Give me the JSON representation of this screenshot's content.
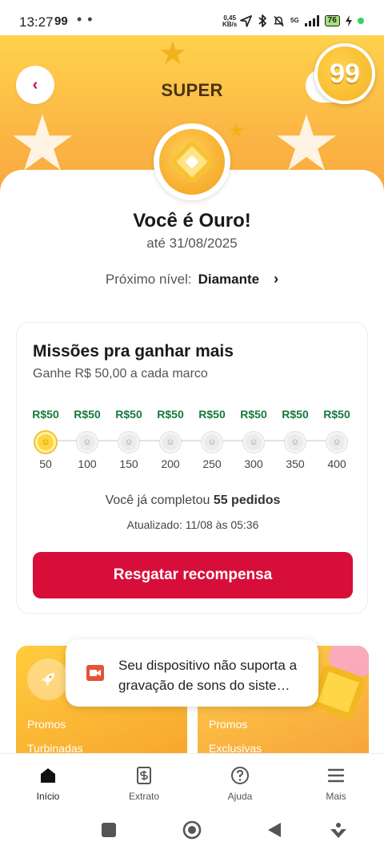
{
  "status_bar": {
    "time": "13:27",
    "app_logo": "99",
    "dots": "• •",
    "net_speed_value": "0,45",
    "net_speed_unit": "KB/s",
    "signal_label": "5G",
    "battery": "76"
  },
  "header": {
    "title": "SUPER",
    "back_icon": "‹",
    "logo_text": "99"
  },
  "level": {
    "title": "Você é Ouro!",
    "until": "até 31/08/2025",
    "next_label": "Próximo nível:",
    "next_value": "Diamante",
    "next_chevron": "›"
  },
  "missions": {
    "title": "Missões pra ganhar mais",
    "subtitle": "Ganhe R$ 50,00 a cada marco",
    "steps": [
      {
        "reward": "R$50",
        "count": "50"
      },
      {
        "reward": "R$50",
        "count": "100"
      },
      {
        "reward": "R$50",
        "count": "150"
      },
      {
        "reward": "R$50",
        "count": "200"
      },
      {
        "reward": "R$50",
        "count": "250"
      },
      {
        "reward": "R$50",
        "count": "300"
      },
      {
        "reward": "R$50",
        "count": "350"
      },
      {
        "reward": "R$50",
        "count": "400"
      }
    ],
    "completed_prefix": "Você já completou",
    "completed_value": "55 pedidos",
    "updated": "Atualizado: 11/08 às 05:36",
    "button": "Resgatar recompensa"
  },
  "promos": {
    "left": {
      "line1": "Promos",
      "line2": "Turbinadas"
    },
    "right": {
      "line1": "Promos",
      "line2": "Exclusivas"
    }
  },
  "toast": {
    "text": "Seu dispositivo não suporta a gravação de sons do siste…"
  },
  "bottom_nav": [
    {
      "label": "Início",
      "icon": "home-icon"
    },
    {
      "label": "Extrato",
      "icon": "receipt-icon"
    },
    {
      "label": "Ajuda",
      "icon": "help-icon"
    },
    {
      "label": "Mais",
      "icon": "menu-icon"
    }
  ],
  "colors": {
    "accent_red": "#d80e3a",
    "reward_green": "#177a3c",
    "header_gold": "#fbb544"
  }
}
